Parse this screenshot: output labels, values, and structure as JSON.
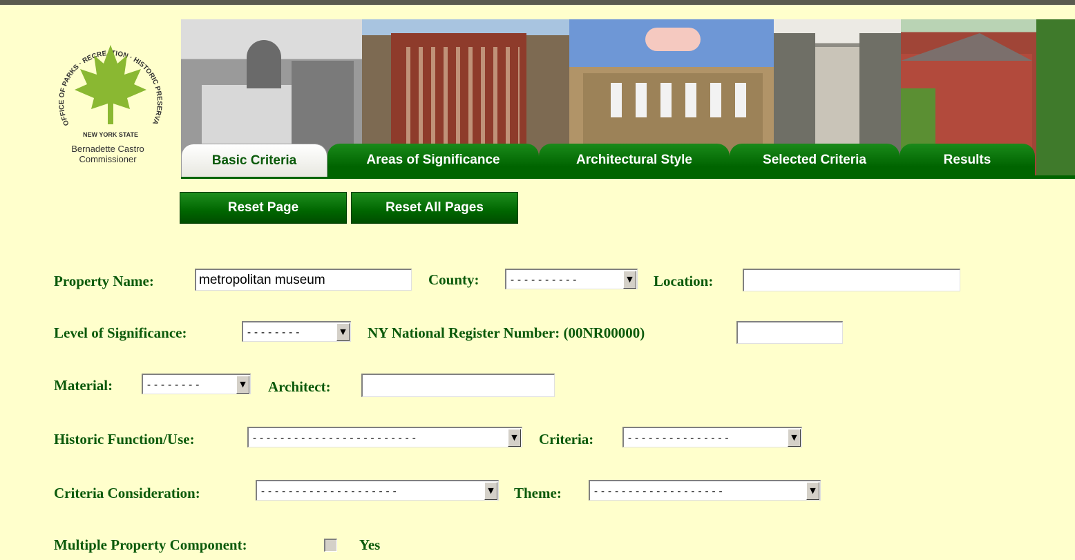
{
  "logo": {
    "arc_text": "OFFICE OF PARKS · RECREATION · HISTORIC PRESERVATION",
    "state": "NEW YORK STATE",
    "commissioner_name": "Bernadette Castro",
    "commissioner_title": "Commissioner",
    "leaf_color": "#8ab832"
  },
  "tabs": [
    {
      "label": "Basic Criteria",
      "active": true
    },
    {
      "label": "Areas of Significance",
      "active": false
    },
    {
      "label": "Architectural Style",
      "active": false
    },
    {
      "label": "Selected Criteria",
      "active": false
    },
    {
      "label": "Results",
      "active": false
    }
  ],
  "actions": {
    "reset_page": "Reset Page",
    "reset_all": "Reset All Pages"
  },
  "form": {
    "property_name": {
      "label": "Property Name:",
      "value": "metropolitan museum"
    },
    "county": {
      "label": "County:",
      "value": "----------"
    },
    "location": {
      "label": "Location:",
      "value": ""
    },
    "level": {
      "label": "Level of Significance:",
      "value": "--------"
    },
    "nr_number": {
      "label": "NY National Register Number: (00NR00000)",
      "value": ""
    },
    "material": {
      "label": "Material:",
      "value": "--------"
    },
    "architect": {
      "label": "Architect:",
      "value": ""
    },
    "historic_function": {
      "label": "Historic Function/Use:",
      "value": "------------------------"
    },
    "criteria": {
      "label": "Criteria:",
      "value": "---------------"
    },
    "criteria_consideration": {
      "label": "Criteria Consideration:",
      "value": "--------------------"
    },
    "theme": {
      "label": "Theme:",
      "value": "-------------------"
    },
    "multiple_property": {
      "label": "Multiple Property Component:",
      "option": "Yes",
      "checked": false
    }
  },
  "colors": {
    "background": "#ffffcc",
    "label_green": "#0b5a0b",
    "tab_green": "#006400"
  }
}
